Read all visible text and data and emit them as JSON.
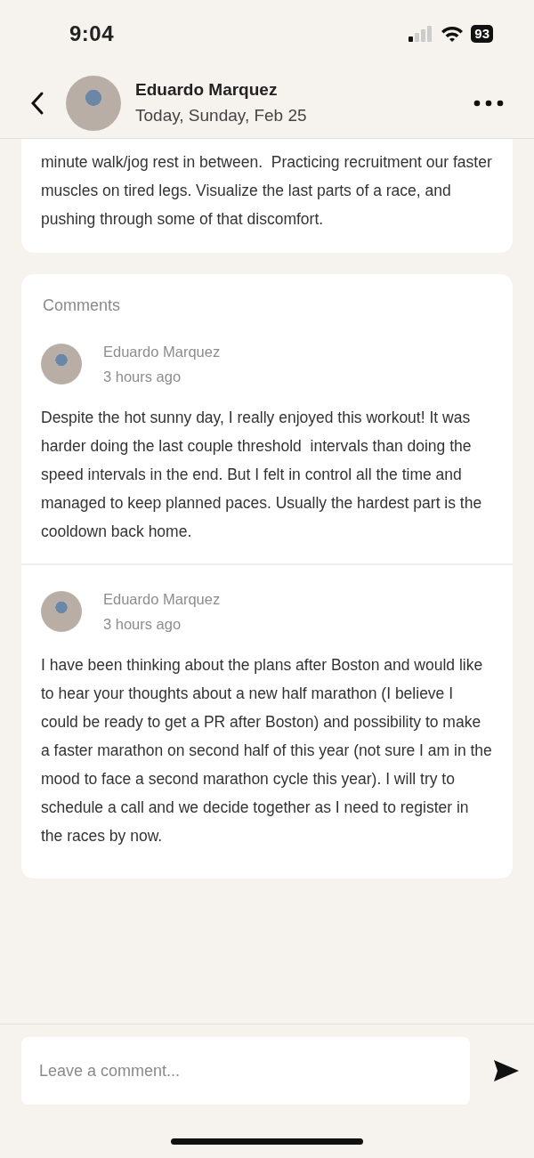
{
  "status_bar": {
    "time": "9:04",
    "battery": "93"
  },
  "header": {
    "name": "Eduardo Marquez",
    "date": "Today, Sunday, Feb 25"
  },
  "workout": {
    "description": "minute walk/jog rest in between.  Practicing recruitment our faster muscles on tired legs. Visualize the last parts of a race, and pushing through some of that discomfort."
  },
  "comments": {
    "title": "Comments",
    "items": [
      {
        "author": "Eduardo Marquez",
        "time": "3 hours ago",
        "text": "Despite the hot sunny day, I really enjoyed this workout! It was harder doing the last couple threshold  intervals than doing the speed intervals in the end. But I felt in control all the time and managed to keep planned paces. Usually the hardest part is the cooldown back home."
      },
      {
        "author": "Eduardo Marquez",
        "time": "3 hours ago",
        "text": "I have been thinking about the plans after Boston and would like to hear your thoughts about a new half marathon (I believe I could be ready to get a PR after Boston) and possibility to make a faster marathon on second half of this year (not sure I am in the mood to face a second marathon cycle this year). I will try to schedule a call and we decide together as I need to register in the races by now."
      }
    ]
  },
  "composer": {
    "placeholder": "Leave a comment..."
  }
}
